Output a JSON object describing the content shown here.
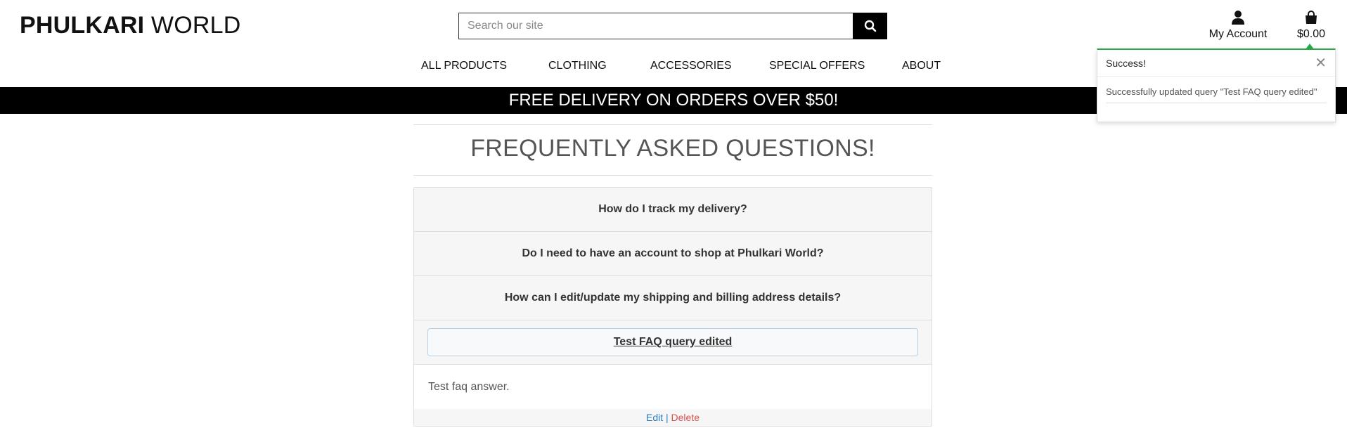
{
  "brand": {
    "bold": "PHULKARI",
    "light": "WORLD"
  },
  "search": {
    "placeholder": "Search our site",
    "value": ""
  },
  "account": {
    "label": "My Account",
    "icon": "user-icon"
  },
  "cart": {
    "total": "$0.00",
    "icon": "shopping-bag-icon"
  },
  "nav": {
    "items": [
      {
        "label": "ALL PRODUCTS"
      },
      {
        "label": "CLOTHING"
      },
      {
        "label": "ACCESSORIES"
      },
      {
        "label": "SPECIAL OFFERS"
      },
      {
        "label": "ABOUT"
      }
    ]
  },
  "banner": {
    "text": "FREE DELIVERY ON ORDERS OVER $50!"
  },
  "faq": {
    "title": "FREQUENTLY ASKED QUESTIONS!",
    "questions": [
      {
        "question": "How do I track my delivery?"
      },
      {
        "question": "Do I need to have an account to shop at Phulkari World?"
      },
      {
        "question": "How can I edit/update my shipping and billing address details?"
      },
      {
        "question": "Test FAQ query edited",
        "answer": "Test faq answer.",
        "expanded": true
      }
    ],
    "actions": {
      "edit": "Edit",
      "separator": "|",
      "delete": "Delete"
    }
  },
  "toast": {
    "title": "Success!",
    "message": "Successfully updated query \"Test FAQ query edited\"",
    "accent": "#28a745"
  },
  "colors": {
    "link": "#2a7ec2",
    "danger": "#d9534f",
    "banner_bg": "#000000"
  }
}
